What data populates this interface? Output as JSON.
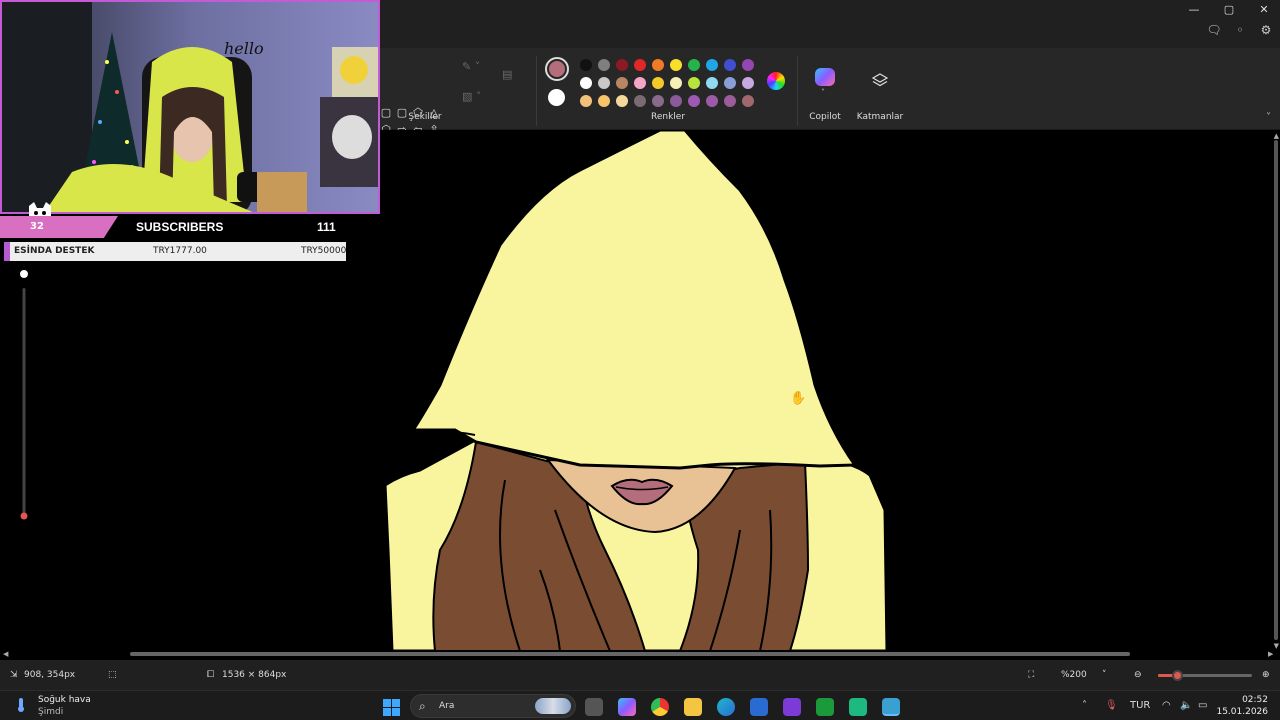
{
  "window": {
    "min_glyph": "—",
    "max_glyph": "▢",
    "close_glyph": "✕"
  },
  "ribbon": {
    "shapes_label": "Şekiller",
    "colors_label": "Renkler",
    "copilot_label": "Copilot",
    "layers_label": "Katmanlar",
    "shape_glyphs": [
      "▢",
      "▢",
      "⬠",
      "△",
      "⬡",
      "⇨",
      "⇦",
      "⇧",
      "▭",
      "◯",
      "◯",
      "◯",
      "✲",
      "",
      "",
      ""
    ],
    "primary_color": "#b46d7a",
    "secondary_color": "#ffffff",
    "swatches": [
      "#111111",
      "#7f7f7f",
      "#8b1a22",
      "#e02828",
      "#f07a26",
      "#f7e02a",
      "#27b34b",
      "#1fa6e6",
      "#3f4fcf",
      "#9446b3",
      "#ffffff",
      "#c8c8c8",
      "#b88664",
      "#f4a6c5",
      "#f5c928",
      "#f4f0b6",
      "#b9e43d",
      "#8fd9f2",
      "#8a9ed6",
      "#c7a8e0",
      "#f3c07a",
      "#f7c36b",
      "#f5d99a",
      "#7a6a74",
      "#8a6a8a",
      "#8a5a9a",
      "#9d59b3",
      "#9c5ba6",
      "#9b5c9a",
      "#a0686e"
    ]
  },
  "status": {
    "cursor_pos": "908, 354px",
    "canvas_size": "1536 × 864px",
    "zoom": "%200",
    "zoom_level_percent": 20
  },
  "taskbar": {
    "weather_title": "Soğuk hava",
    "weather_sub": "Şimdi",
    "search_placeholder": "Ara",
    "language": "TUR",
    "time": "02:52",
    "date": "15.01.2026"
  },
  "overlay": {
    "subs_count_left": "32",
    "subs_label": "SUBSCRIBERS",
    "subs_count_right": "111",
    "donation_label": "ESİNDA DESTEK",
    "donation_current": "TRY1777.00",
    "donation_goal": "TRY50000",
    "webcam_sign_text": "hello"
  },
  "colors": {
    "accent": "#e0574f",
    "overlay_purple": "#c45bd6",
    "hood_yellow": "#f9f59e",
    "hair_brown": "#7a4d33",
    "face_skin": "#e8c294"
  }
}
